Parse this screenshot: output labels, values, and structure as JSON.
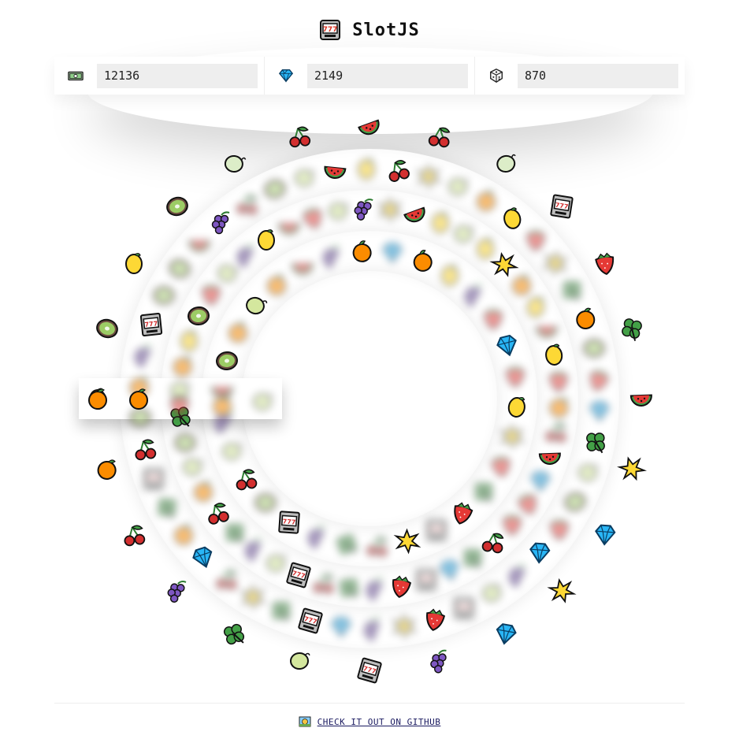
{
  "app": {
    "title": "SlotJS"
  },
  "stats": [
    {
      "icon": "banknote-icon",
      "value": "12136"
    },
    {
      "icon": "gem-icon",
      "value": "2149"
    },
    {
      "icon": "dice-icon",
      "value": "870"
    }
  ],
  "reels": {
    "outer": [
      "watermelon",
      "cherries",
      "lemon-green",
      "slot-machine",
      "strawberry",
      "clover",
      "watermelon",
      "collision",
      "gem",
      "collision",
      "gem",
      "grapes",
      "slot-machine",
      "lime",
      "clover",
      "grapes",
      "cherries",
      "orange",
      "lemon",
      "kiwi",
      "lemon",
      "kiwi",
      "lemon-green",
      "cherries"
    ],
    "ring3": [
      "cherries",
      "lime",
      "lemon",
      "collision",
      "orange",
      "strawberry",
      "clover",
      "kiwi",
      "gem",
      "lime",
      "strawberry",
      "grapes",
      "slot-machine",
      "collision",
      "gem",
      "clover",
      "cherries",
      "orange",
      "slot-machine",
      "kiwi",
      "grapes",
      "kiwi",
      "watermelon"
    ],
    "ring2": [
      "watermelon",
      "lime",
      "collision",
      "lemon",
      "lemon",
      "orange",
      "watermelon",
      "strawberry",
      "cherries",
      "gem",
      "strawberry",
      "clover",
      "slot-machine",
      "grapes",
      "cherries",
      "lime",
      "clover",
      "orange",
      "kiwi",
      "lime",
      "lemon",
      "strawberry",
      "grapes"
    ],
    "inner": [
      "orange",
      "grapes",
      "gem",
      "lemon",
      "strawberry",
      "strawberry",
      "collision",
      "clover",
      "slot-machine",
      "cherries",
      "grapes",
      "kiwi",
      "lime",
      "watermelon",
      "orange"
    ]
  },
  "footer": {
    "link_label": "CHECK IT OUT ON GITHUB"
  }
}
